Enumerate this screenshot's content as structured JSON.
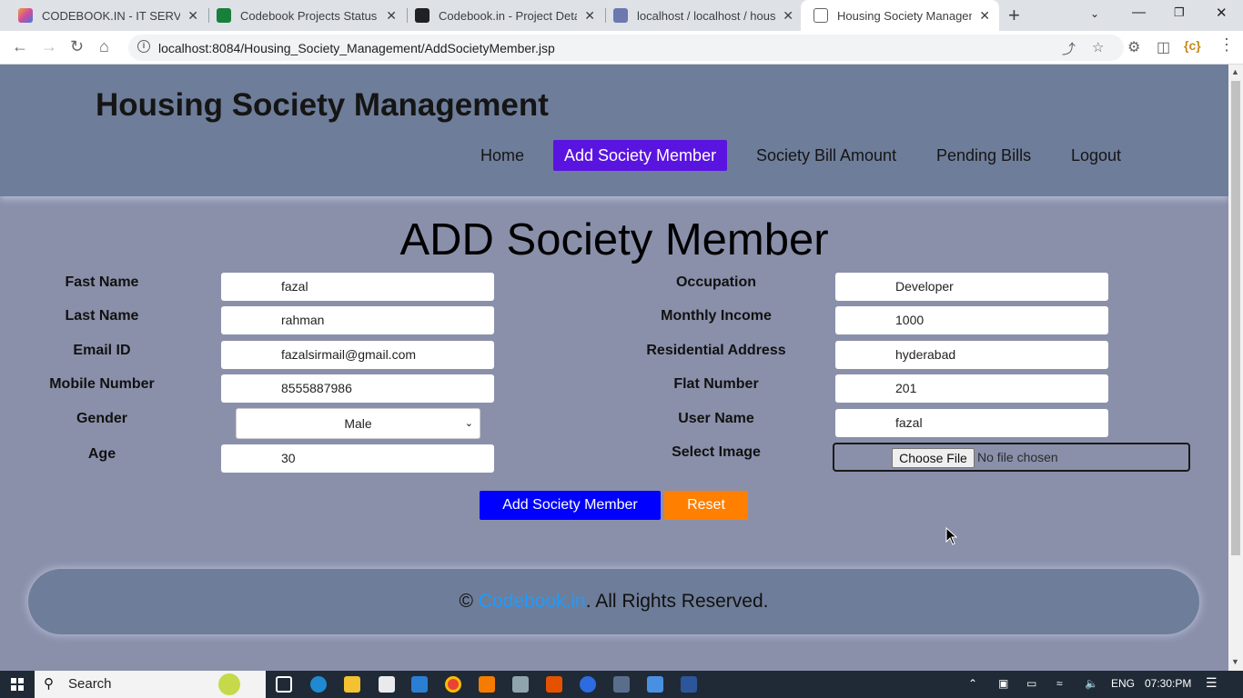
{
  "browser": {
    "tabs": [
      {
        "title": "CODEBOOK.IN - IT SERVICES",
        "color": "#e8a33d"
      },
      {
        "title": "Codebook Projects Status Re",
        "color": "#188038"
      },
      {
        "title": "Codebook.in - Project Details",
        "color": "#202124"
      },
      {
        "title": "localhost / localhost / housin",
        "color": "#6c78af"
      },
      {
        "title": "Housing Society Managemen",
        "color": "#ffffff"
      }
    ],
    "close_glyph": "✕",
    "new_tab_glyph": "+",
    "url": "localhost:8084/Housing_Society_Management/AddSocietyMember.jsp"
  },
  "header": {
    "title": "Housing Society Management",
    "nav": [
      "Home",
      "Add Society Member",
      "Society Bill Amount",
      "Pending Bills",
      "Logout"
    ],
    "active_nav": "Add Society Member",
    "active_color": "#5a14e0"
  },
  "form": {
    "heading": "ADD Society Member",
    "left": {
      "first_name": {
        "label": "Fast Name",
        "value": "fazal"
      },
      "last_name": {
        "label": "Last Name",
        "value": "rahman"
      },
      "email": {
        "label": "Email ID",
        "value": "fazalsirmail@gmail.com"
      },
      "mobile": {
        "label": "Mobile Number",
        "value": "8555887986"
      },
      "gender": {
        "label": "Gender",
        "value": "Male"
      },
      "age": {
        "label": "Age",
        "value": "30"
      }
    },
    "right": {
      "occupation": {
        "label": "Occupation",
        "value": "Developer"
      },
      "income": {
        "label": "Monthly Income",
        "value": "1000"
      },
      "address": {
        "label": "Residential Address",
        "value": "hyderabad"
      },
      "flat": {
        "label": "Flat Number",
        "value": "201"
      },
      "username": {
        "label": "User Name",
        "value": "fazal"
      },
      "image": {
        "label": "Select Image",
        "button": "Choose File",
        "status": "No file chosen"
      }
    },
    "submit_label": "Add Society Member",
    "reset_label": "Reset",
    "submit_color": "#0000ff",
    "reset_color": "#ff7f00"
  },
  "footer": {
    "prefix": "© ",
    "brand": "Codebook.in",
    "suffix": ". All Rights Reserved."
  },
  "taskbar": {
    "search_placeholder": "Search",
    "language": "ENG",
    "time": "07:30:PM"
  }
}
